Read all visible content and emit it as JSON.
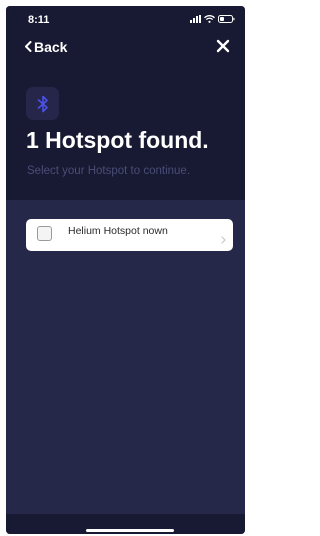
{
  "status_bar": {
    "time": "8:11"
  },
  "nav": {
    "back_label": "Back"
  },
  "header": {
    "title": "1 Hotspot found.",
    "subtitle": "Select your Hotspot to continue."
  },
  "hotspots": [
    {
      "name": "Helium Hotspot nown"
    }
  ],
  "icons": {
    "bluetooth": "bluetooth-icon",
    "back": "chevron-left-icon",
    "close": "close-icon",
    "row": "chevron-right-icon"
  },
  "colors": {
    "background": "#181932",
    "list_background": "#26284a",
    "accent": "#4a52e8",
    "subtitle": "#4a4d76"
  }
}
